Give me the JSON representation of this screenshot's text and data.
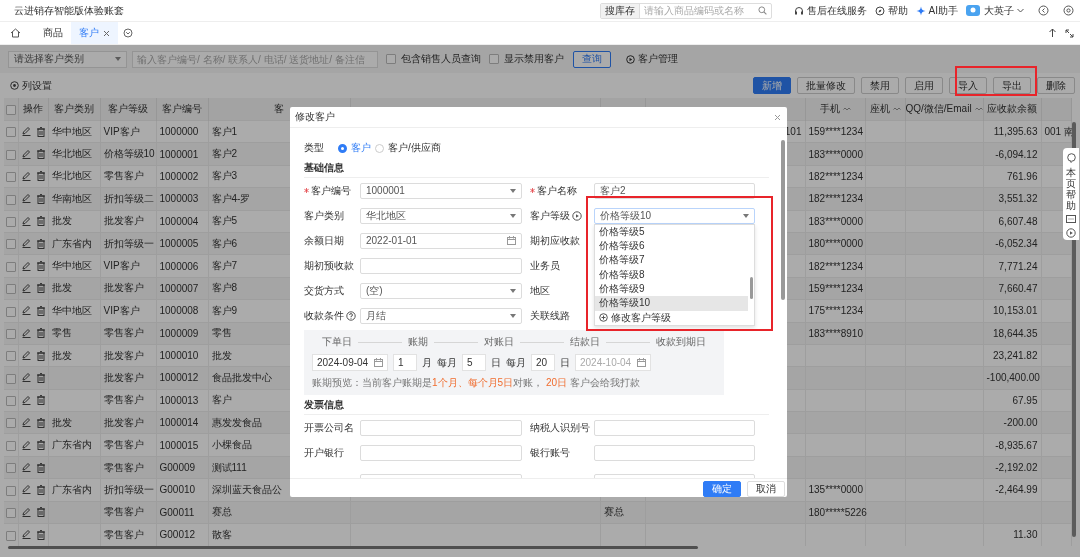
{
  "app": {
    "title": "云进销存智能版体验账套",
    "search": {
      "scope": "搜库存",
      "placeholder": "请输入商品编码或名称"
    },
    "links": [
      {
        "kind": "service",
        "label": "售后在线服务"
      },
      {
        "kind": "help",
        "label": "帮助"
      },
      {
        "kind": "ai",
        "label": "AI助手"
      }
    ],
    "user": "大英子"
  },
  "tabs": [
    {
      "label": "商品",
      "selected": false,
      "closable": false
    },
    {
      "label": "客户",
      "selected": true,
      "closable": true
    }
  ],
  "filters": {
    "category": {
      "placeholder": "请选择客户类别"
    },
    "keyword": {
      "placeholder": "输入客户编号/ 名称/ 联系人/ 电话/ 送货地址/ 备注信"
    },
    "checkboxes": [
      {
        "label": "包含销售人员查询",
        "checked": false
      },
      {
        "label": "显示禁用客户",
        "checked": false
      }
    ],
    "query": "查询",
    "manage": "客户管理"
  },
  "column_settings": "列设置",
  "actions": [
    {
      "label": "新增",
      "primary": true
    },
    {
      "label": "批量修改",
      "primary": false
    },
    {
      "label": "禁用",
      "primary": false
    },
    {
      "label": "启用",
      "primary": false
    },
    {
      "label": "导入",
      "primary": false
    },
    {
      "label": "导出",
      "primary": false
    },
    {
      "label": "删除",
      "primary": false
    }
  ],
  "table": {
    "header_checked": false,
    "columns": [
      {
        "kind": "actions",
        "label": "操作"
      },
      {
        "kind": "text",
        "label": "客户类别"
      },
      {
        "kind": "text",
        "label": "客户等级"
      },
      {
        "kind": "text",
        "label": "客户编号"
      },
      {
        "kind": "text",
        "label": "客"
      },
      {
        "kind": "text"
      },
      {
        "kind": "text"
      },
      {
        "kind": "number"
      },
      {
        "kind": "text",
        "label": "手机",
        "sortable": true
      },
      {
        "kind": "text",
        "label": "座机",
        "sortable": true
      },
      {
        "kind": "text",
        "label": "QQ/微信/Email",
        "sortable": true
      },
      {
        "kind": "number",
        "label": "应收款余额"
      },
      {
        "kind": "text"
      }
    ],
    "rows": [
      {
        "checked": false,
        "category": "华中地区",
        "level": "VIP客户",
        "code": "1000000",
        "name": "客户1",
        "column_8": "101",
        "mobile": "159****1234",
        "balance": "11,395.63",
        "column_13": "001 南"
      },
      {
        "checked": false,
        "category": "华北地区",
        "level": "价格等级10",
        "code": "1000001",
        "name": "客户2",
        "mobile": "183****0000",
        "balance": "-6,094.12"
      },
      {
        "checked": false,
        "category": "华北地区",
        "level": "零售客户",
        "code": "1000002",
        "name": "客户3",
        "mobile": "182****1234",
        "balance": "761.96"
      },
      {
        "checked": false,
        "category": "华南地区",
        "level": "折扣等级二",
        "code": "1000003",
        "name": "客户4-罗",
        "mobile": "182****1234",
        "balance": "3,551.32"
      },
      {
        "checked": false,
        "category": "批发",
        "level": "批发客户",
        "code": "1000004",
        "name": "客户5",
        "mobile": "183****0000",
        "balance": "6,607.48"
      },
      {
        "checked": false,
        "category": "广东省内",
        "level": "折扣等级一",
        "code": "1000005",
        "name": "客户6",
        "mobile": "180****0000",
        "balance": "-6,052.34"
      },
      {
        "checked": false,
        "category": "华中地区",
        "level": "VIP客户",
        "code": "1000006",
        "name": "客户7",
        "mobile": "182****1234",
        "balance": "7,771.24"
      },
      {
        "checked": false,
        "category": "批发",
        "level": "批发客户",
        "code": "1000007",
        "name": "客户8",
        "mobile": "159****1234",
        "balance": "7,660.47"
      },
      {
        "checked": false,
        "category": "华中地区",
        "level": "VIP客户",
        "code": "1000008",
        "name": "客户9",
        "mobile": "175****1234",
        "balance": "10,153.01"
      },
      {
        "checked": false,
        "category": "零售",
        "level": "零售客户",
        "code": "1000009",
        "name": "零售",
        "mobile": "183****8910",
        "balance": "18,644.35"
      },
      {
        "checked": false,
        "category": "批发",
        "level": "批发客户",
        "code": "1000010",
        "name": "批发",
        "balance": "23,241.82"
      },
      {
        "checked": false,
        "level": "批发客户",
        "code": "1000012",
        "name": "食品批发中心",
        "balance": "-100,400.00"
      },
      {
        "checked": false,
        "level": "零售客户",
        "code": "1000013",
        "name": "客户",
        "balance": "67.95"
      },
      {
        "checked": false,
        "category": "批发",
        "level": "批发客户",
        "code": "1000014",
        "name": "惠发发食品",
        "balance": "-200.00"
      },
      {
        "checked": false,
        "category": "广东省内",
        "level": "零售客户",
        "code": "1000015",
        "name": "小棵食品",
        "balance": "-8,935.67"
      },
      {
        "checked": false,
        "level": "零售客户",
        "code": "G00009",
        "name": "测试111",
        "balance": "-2,192.02"
      },
      {
        "checked": false,
        "category": "广东省内",
        "level": "折扣等级一",
        "code": "G00010",
        "name": "深圳蓝天食品公",
        "mobile": "135****0000",
        "balance": "-2,464.99"
      },
      {
        "checked": false,
        "level": "零售客户",
        "code": "G00011",
        "name": "赛总",
        "column_7": "赛总",
        "mobile": "180*****5226"
      },
      {
        "checked": false,
        "level": "零售客户",
        "code": "G00012",
        "name": "散客",
        "balance": "11.30"
      }
    ]
  },
  "dialog": {
    "title": "修改客户",
    "type": {
      "label": "类型",
      "options": [
        {
          "label": "客户",
          "selected": true
        },
        {
          "label": "客户/供应商",
          "selected": false
        }
      ]
    },
    "sections": [
      {
        "title": "基础信息",
        "rows": [
          [
            {
              "label": "客户编号",
              "required": true,
              "kind": "select",
              "value": "1000001"
            },
            {
              "label": "客户名称",
              "required": true,
              "kind": "text",
              "value": "客户2"
            }
          ],
          [
            {
              "label": "客户类别",
              "required": false,
              "kind": "select",
              "value": "华北地区"
            },
            {
              "label": "客户等级",
              "required": false,
              "kind": "select",
              "value": "价格等级10",
              "level_link": true,
              "open": true
            }
          ],
          [
            {
              "label": "余额日期",
              "required": false,
              "kind": "date",
              "value": "2022-01-01"
            },
            {
              "label": "期初应收款",
              "required": false,
              "kind": "covered"
            }
          ],
          [
            {
              "label": "期初预收款",
              "required": false,
              "kind": "text"
            },
            {
              "label": "业务员",
              "required": false,
              "kind": "covered"
            }
          ],
          [
            {
              "label": "交货方式",
              "required": false,
              "kind": "select",
              "value": "(空)"
            },
            {
              "label": "地区",
              "required": false,
              "kind": "covered"
            }
          ],
          [
            {
              "label": "收款条件",
              "required": false,
              "kind": "select",
              "value": "月结",
              "help": true
            },
            {
              "label": "关联线路",
              "required": false,
              "kind": "covered"
            }
          ]
        ],
        "dropdown": {
          "options": [
            {
              "label": "价格等级5",
              "selected": false
            },
            {
              "label": "价格等级6",
              "selected": false
            },
            {
              "label": "价格等级7",
              "selected": false
            },
            {
              "label": "价格等级8",
              "selected": false
            },
            {
              "label": "价格等级9",
              "selected": false
            },
            {
              "label": "价格等级10",
              "selected": true
            }
          ],
          "footer": "修改客户等级"
        },
        "payment_terms": {
          "steps": [
            "下单日",
            "账期",
            "对账日",
            "结款日",
            "收款到期日"
          ],
          "order_date": {
            "value": "2024-09-04",
            "disabled": false
          },
          "period": {
            "value": "1",
            "unit": "月"
          },
          "statement": {
            "prefix": "每月",
            "value": "5",
            "unit": "日"
          },
          "payday": {
            "prefix": "每月",
            "value": "20",
            "unit": "日"
          },
          "due_date": {
            "value": "2024-10-04",
            "disabled": true
          },
          "preview": "账期预览：当前客户账期是**1个月、每个月5日**对账， **20日** 客户会给我打款"
        }
      },
      {
        "title": "发票信息",
        "rows": [
          [
            {
              "label": "开票公司名",
              "required": false,
              "kind": "text"
            },
            {
              "label": "纳税人识别号",
              "required": false,
              "kind": "text"
            }
          ],
          [
            {
              "label": "开户银行",
              "required": false,
              "kind": "text"
            },
            {
              "label": "银行账号",
              "required": false,
              "kind": "text"
            }
          ],
          [
            {
              "kind": "cut"
            },
            {
              "kind": "cut"
            }
          ]
        ]
      }
    ],
    "buttons": [
      {
        "label": "确定",
        "primary": true
      },
      {
        "label": "取消",
        "primary": false
      }
    ]
  },
  "side_help": {
    "label": "本页帮助"
  }
}
